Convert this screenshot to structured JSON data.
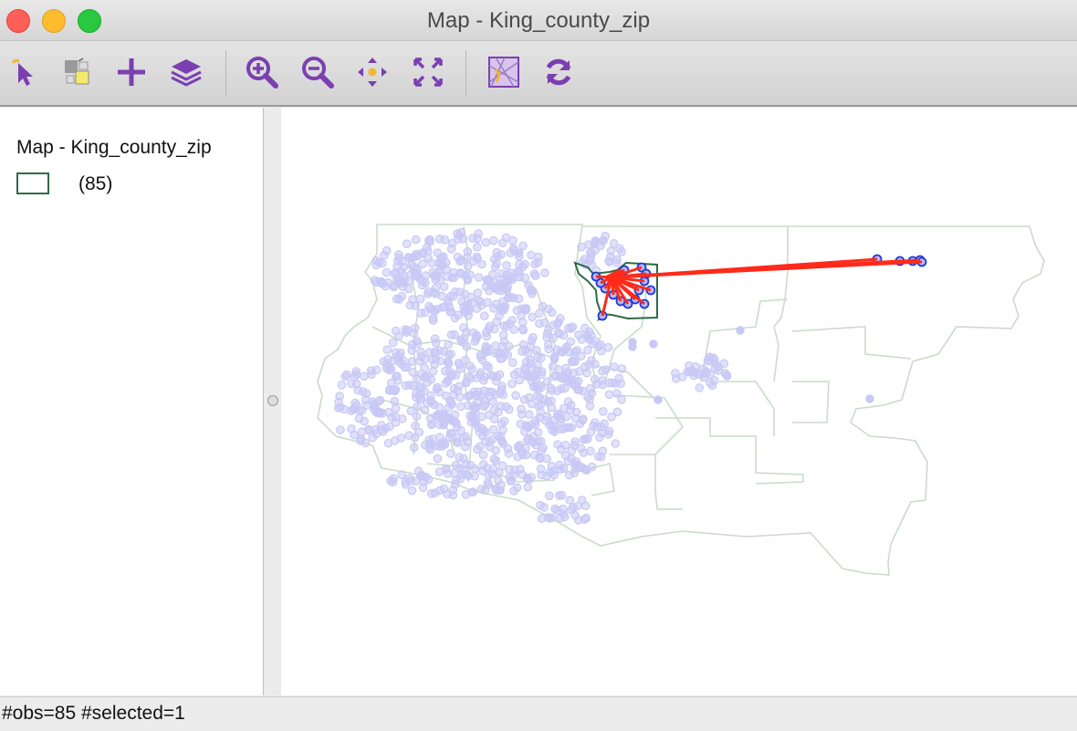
{
  "window": {
    "title": "Map - King_county_zip"
  },
  "toolbar": {
    "buttons": [
      {
        "name": "select-tool",
        "icon": "pointer-arrow-icon"
      },
      {
        "name": "selection-shape",
        "icon": "select-shape-icon"
      },
      {
        "name": "add-layer",
        "icon": "plus-icon"
      },
      {
        "name": "layers",
        "icon": "layers-stack-icon"
      },
      {
        "name": "zoom-in",
        "icon": "zoom-in-icon"
      },
      {
        "name": "zoom-out",
        "icon": "zoom-out-icon"
      },
      {
        "name": "pan",
        "icon": "pan-arrows-icon"
      },
      {
        "name": "full-extent",
        "icon": "fit-extent-icon"
      },
      {
        "name": "basemap",
        "icon": "basemap-icon"
      },
      {
        "name": "refresh",
        "icon": "refresh-icon"
      }
    ],
    "accent_color": "#7b3fb0"
  },
  "legend": {
    "title": "Map - King_county_zip",
    "layer_count": "(85)",
    "swatch_color": "#2e6b47"
  },
  "map": {
    "boundary_color": "#c9dcc9",
    "point_color": "#c8c8f5",
    "selected_outline_color": "#2e6b47",
    "highlight_point_color": "#1f3ad6",
    "arrow_color": "#ff2a1a"
  },
  "status": {
    "text": "#obs=85 #selected=1"
  }
}
